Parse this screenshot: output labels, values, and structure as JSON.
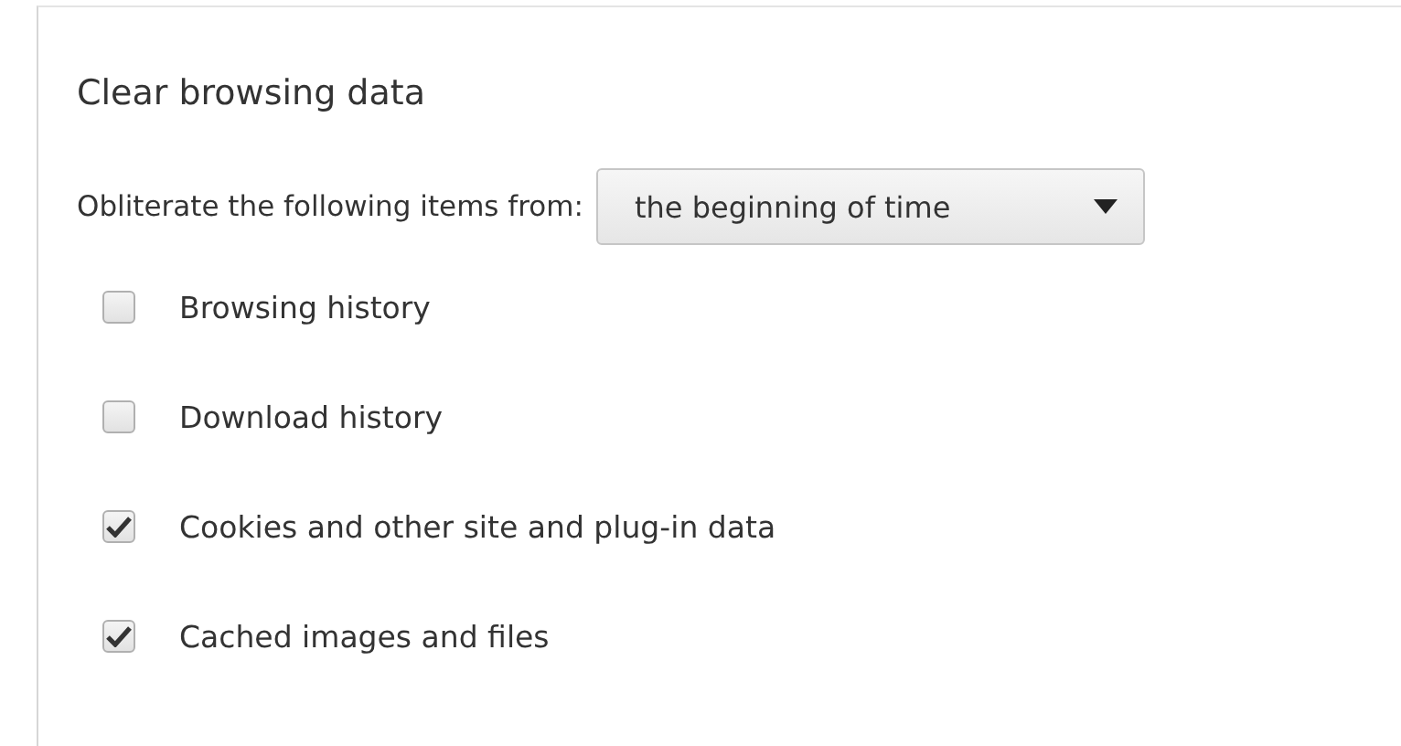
{
  "dialog": {
    "title": "Clear browsing data",
    "period": {
      "label": "Obliterate the following items from:",
      "value": "the beginning of time"
    },
    "items": [
      {
        "label": "Browsing history",
        "checked": false
      },
      {
        "label": "Download history",
        "checked": false
      },
      {
        "label": "Cookies and other site and plug-in data",
        "checked": true
      },
      {
        "label": "Cached images and files",
        "checked": true
      }
    ]
  }
}
